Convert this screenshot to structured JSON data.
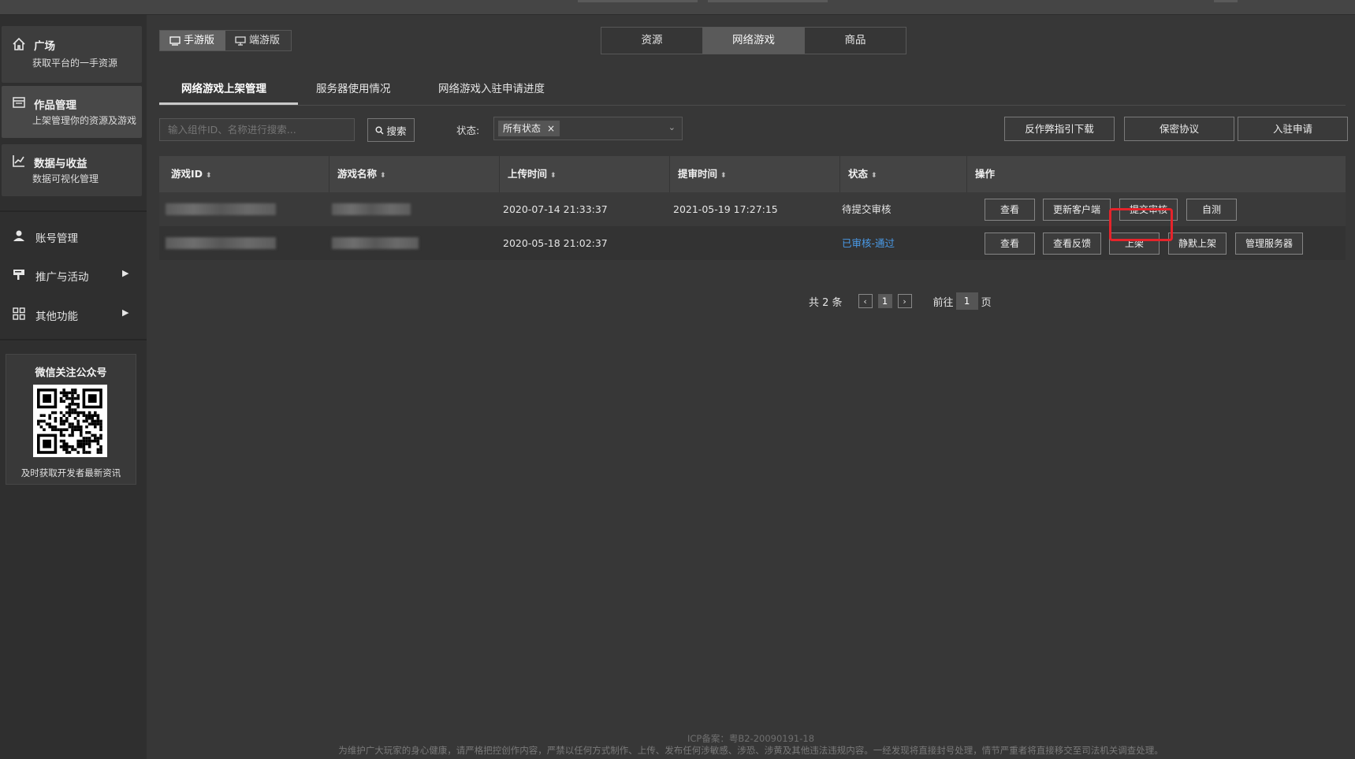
{
  "sidebar": {
    "cards": [
      {
        "title": "广场",
        "sub": "获取平台的一手资源",
        "icon": "home-icon"
      },
      {
        "title": "作品管理",
        "sub": "上架管理你的资源及游戏",
        "icon": "folder-icon"
      },
      {
        "title": "数据与收益",
        "sub": "数据可视化管理",
        "icon": "chart-icon"
      }
    ],
    "items": [
      {
        "label": "账号管理",
        "icon": "user-icon"
      },
      {
        "label": "推广与活动",
        "icon": "promo-icon",
        "arrow": "▶"
      },
      {
        "label": "其他功能",
        "icon": "grid-icon",
        "arrow": "▶"
      }
    ],
    "qr": {
      "title": "微信关注公众号",
      "caption": "及时获取开发者最新资讯"
    }
  },
  "version_toggle": {
    "mobile": "手游版",
    "pc": "端游版"
  },
  "category_tabs": [
    "资源",
    "网络游戏",
    "商品"
  ],
  "sub_tabs": [
    "网络游戏上架管理",
    "服务器使用情况",
    "网络游戏入驻申请进度"
  ],
  "search": {
    "placeholder": "输入组件ID、名称进行搜索...",
    "button": "搜索"
  },
  "status_filter": {
    "label": "状态:",
    "selected": "所有状态",
    "remove": "×",
    "chevron": "⌄"
  },
  "action_buttons": [
    "反作弊指引下载",
    "保密协议",
    "入驻申请"
  ],
  "table": {
    "headers": [
      "游戏ID",
      "游戏名称",
      "上传时间",
      "提审时间",
      "状态",
      "操作"
    ],
    "sort_glyph": "⬍",
    "rows": [
      {
        "upload_time": "2020-07-14 21:33:37",
        "review_time": "2021-05-19 17:27:15",
        "status": "待提交审核",
        "ops": [
          "查看",
          "更新客户端",
          "提交审核",
          "自测"
        ]
      },
      {
        "upload_time": "2020-05-18 21:02:37",
        "review_time": "",
        "status": "已审核-通过",
        "ops": [
          "查看",
          "查看反馈",
          "上架",
          "静默上架",
          "管理服务器"
        ]
      }
    ]
  },
  "pagination": {
    "total": "共 2 条",
    "prev": "‹",
    "current": "1",
    "next": "›",
    "goto_prefix": "前往",
    "goto_value": "1",
    "goto_suffix": "页"
  },
  "footer": {
    "icp": "ICP备案：粤B2-20090191-18",
    "notice": "为维护广大玩家的身心健康，请严格把控创作内容，严禁以任何方式制作、上传、发布任何涉敏感、涉恐、涉黄及其他违法违规内容。一经发现将直接封号处理，情节严重者将直接移交至司法机关调查处理。"
  },
  "colors": {
    "highlight": "#e5242b",
    "link": "#4a9be8"
  }
}
